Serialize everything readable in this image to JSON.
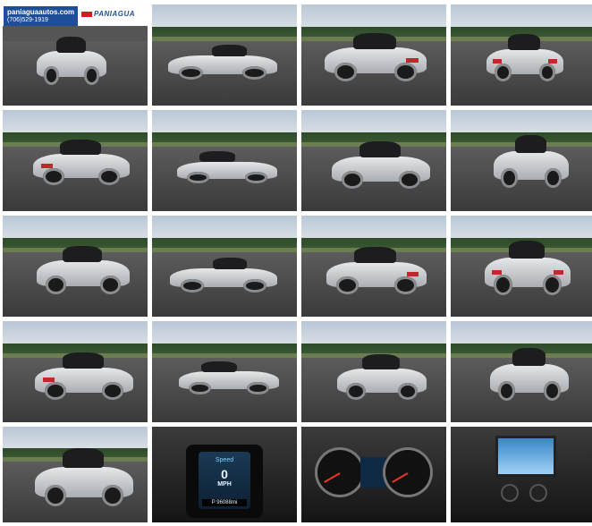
{
  "dealer": {
    "site": "paniaguaautos.com",
    "phone": "(706)529-1919",
    "brand": "PANIAGUA"
  },
  "dashboard": {
    "speed_label": "Speed",
    "speed_value": "0",
    "speed_unit": "MPH",
    "gear": "P",
    "odometer": "96088mi"
  },
  "photos": [
    {
      "view": "front-left"
    },
    {
      "view": "side-left-open"
    },
    {
      "view": "rear-right"
    },
    {
      "view": "rear"
    },
    {
      "view": "rear-left"
    },
    {
      "view": "side-left"
    },
    {
      "view": "front-right"
    },
    {
      "view": "front"
    },
    {
      "view": "front-left-open"
    },
    {
      "view": "side-left-open"
    },
    {
      "view": "rear-right-open"
    },
    {
      "view": "rear-open"
    },
    {
      "view": "rear-left"
    },
    {
      "view": "side-left"
    },
    {
      "view": "front-right"
    },
    {
      "view": "front"
    },
    {
      "view": "front-left"
    },
    {
      "view": "speedometer"
    },
    {
      "view": "gauges"
    },
    {
      "view": "console"
    }
  ]
}
